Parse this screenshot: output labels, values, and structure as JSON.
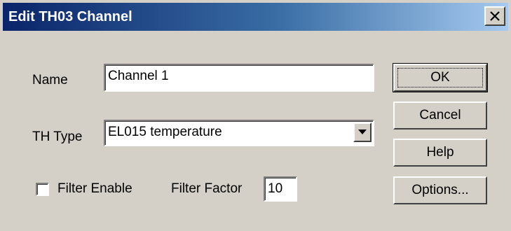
{
  "window": {
    "title": "Edit TH03 Channel",
    "close_glyph": "✕"
  },
  "form": {
    "name_label": "Name",
    "name_value": "Channel 1",
    "th_type_label": "TH Type",
    "th_type_value": "EL015 temperature",
    "filter_enable_label": "Filter Enable",
    "filter_enable_checked": false,
    "filter_factor_label": "Filter Factor",
    "filter_factor_value": "10"
  },
  "buttons": {
    "ok": "OK",
    "cancel": "Cancel",
    "help": "Help",
    "options": "Options..."
  },
  "icons": {
    "close": "close-icon",
    "dropdown": "chevron-down-icon"
  },
  "colors": {
    "face": "#d4d0c8",
    "title_start": "#0a246a",
    "title_end": "#a6caf0"
  }
}
